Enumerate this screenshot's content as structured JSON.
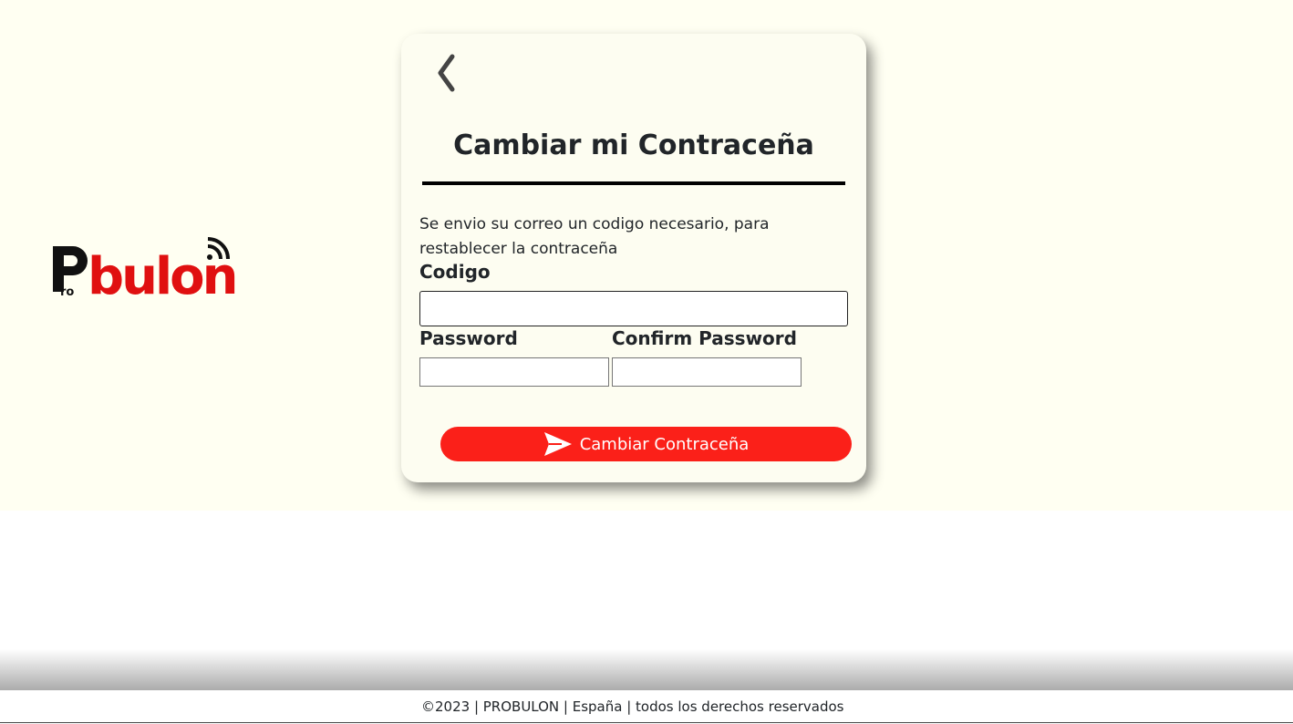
{
  "brand": {
    "logo_prefix": "Pro",
    "logo_name": "bulon",
    "colors": {
      "accent": "#e01010",
      "dark": "#111111"
    }
  },
  "card": {
    "back_icon": "chevron-left-icon",
    "title": "Cambiar mi Contraceña",
    "info_text": "Se envio su correo un codigo necesario, para restablecer la contraceña",
    "fields": {
      "code_label": "Codigo",
      "code_value": "",
      "password_label": "Password",
      "password_value": "",
      "confirm_label": "Confirm Password",
      "confirm_value": ""
    },
    "submit_label": "Cambiar Contraceña",
    "submit_icon": "send-icon",
    "colors": {
      "background": "#fdfdf1",
      "button": "#fb2019"
    }
  },
  "page": {
    "colors": {
      "hero_background": "#fffff2"
    }
  },
  "footer": {
    "text": "©2023 | PROBULON | España | todos los derechos reservados"
  }
}
